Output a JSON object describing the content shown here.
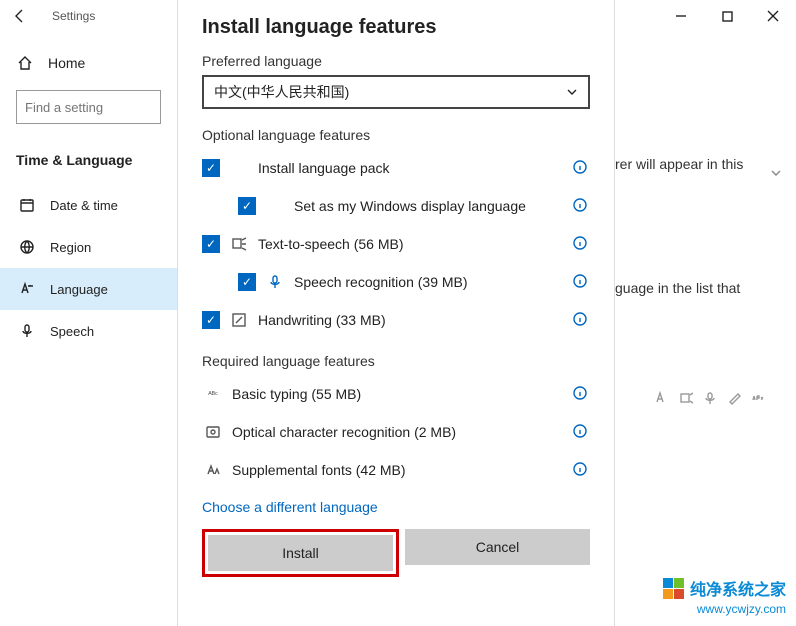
{
  "titlebar": {
    "title": "Settings"
  },
  "sidebar": {
    "home": "Home",
    "search_placeholder": "Find a setting",
    "group": "Time & Language",
    "items": [
      {
        "label": "Date & time"
      },
      {
        "label": "Region"
      },
      {
        "label": "Language"
      },
      {
        "label": "Speech"
      }
    ]
  },
  "page": {
    "frag1": "rer will appear in this",
    "frag2": "guage in the list that"
  },
  "dialog": {
    "title": "Install language features",
    "preferred_label": "Preferred language",
    "preferred_value": "中文(中华人民共和国)",
    "optional_header": "Optional language features",
    "features": [
      {
        "label": "Install language pack",
        "checked": true
      },
      {
        "label": "Set as my Windows display language",
        "checked": true
      },
      {
        "label": "Text-to-speech (56 MB)",
        "checked": true
      },
      {
        "label": "Speech recognition (39 MB)",
        "checked": true
      },
      {
        "label": "Handwriting (33 MB)",
        "checked": true
      }
    ],
    "required_header": "Required language features",
    "required": [
      {
        "label": "Basic typing (55 MB)"
      },
      {
        "label": "Optical character recognition (2 MB)"
      },
      {
        "label": "Supplemental fonts (42 MB)"
      }
    ],
    "choose_link": "Choose a different language",
    "install": "Install",
    "cancel": "Cancel"
  },
  "watermark": {
    "brand": "纯净系统之家",
    "url": "www.ycwjzy.com"
  }
}
